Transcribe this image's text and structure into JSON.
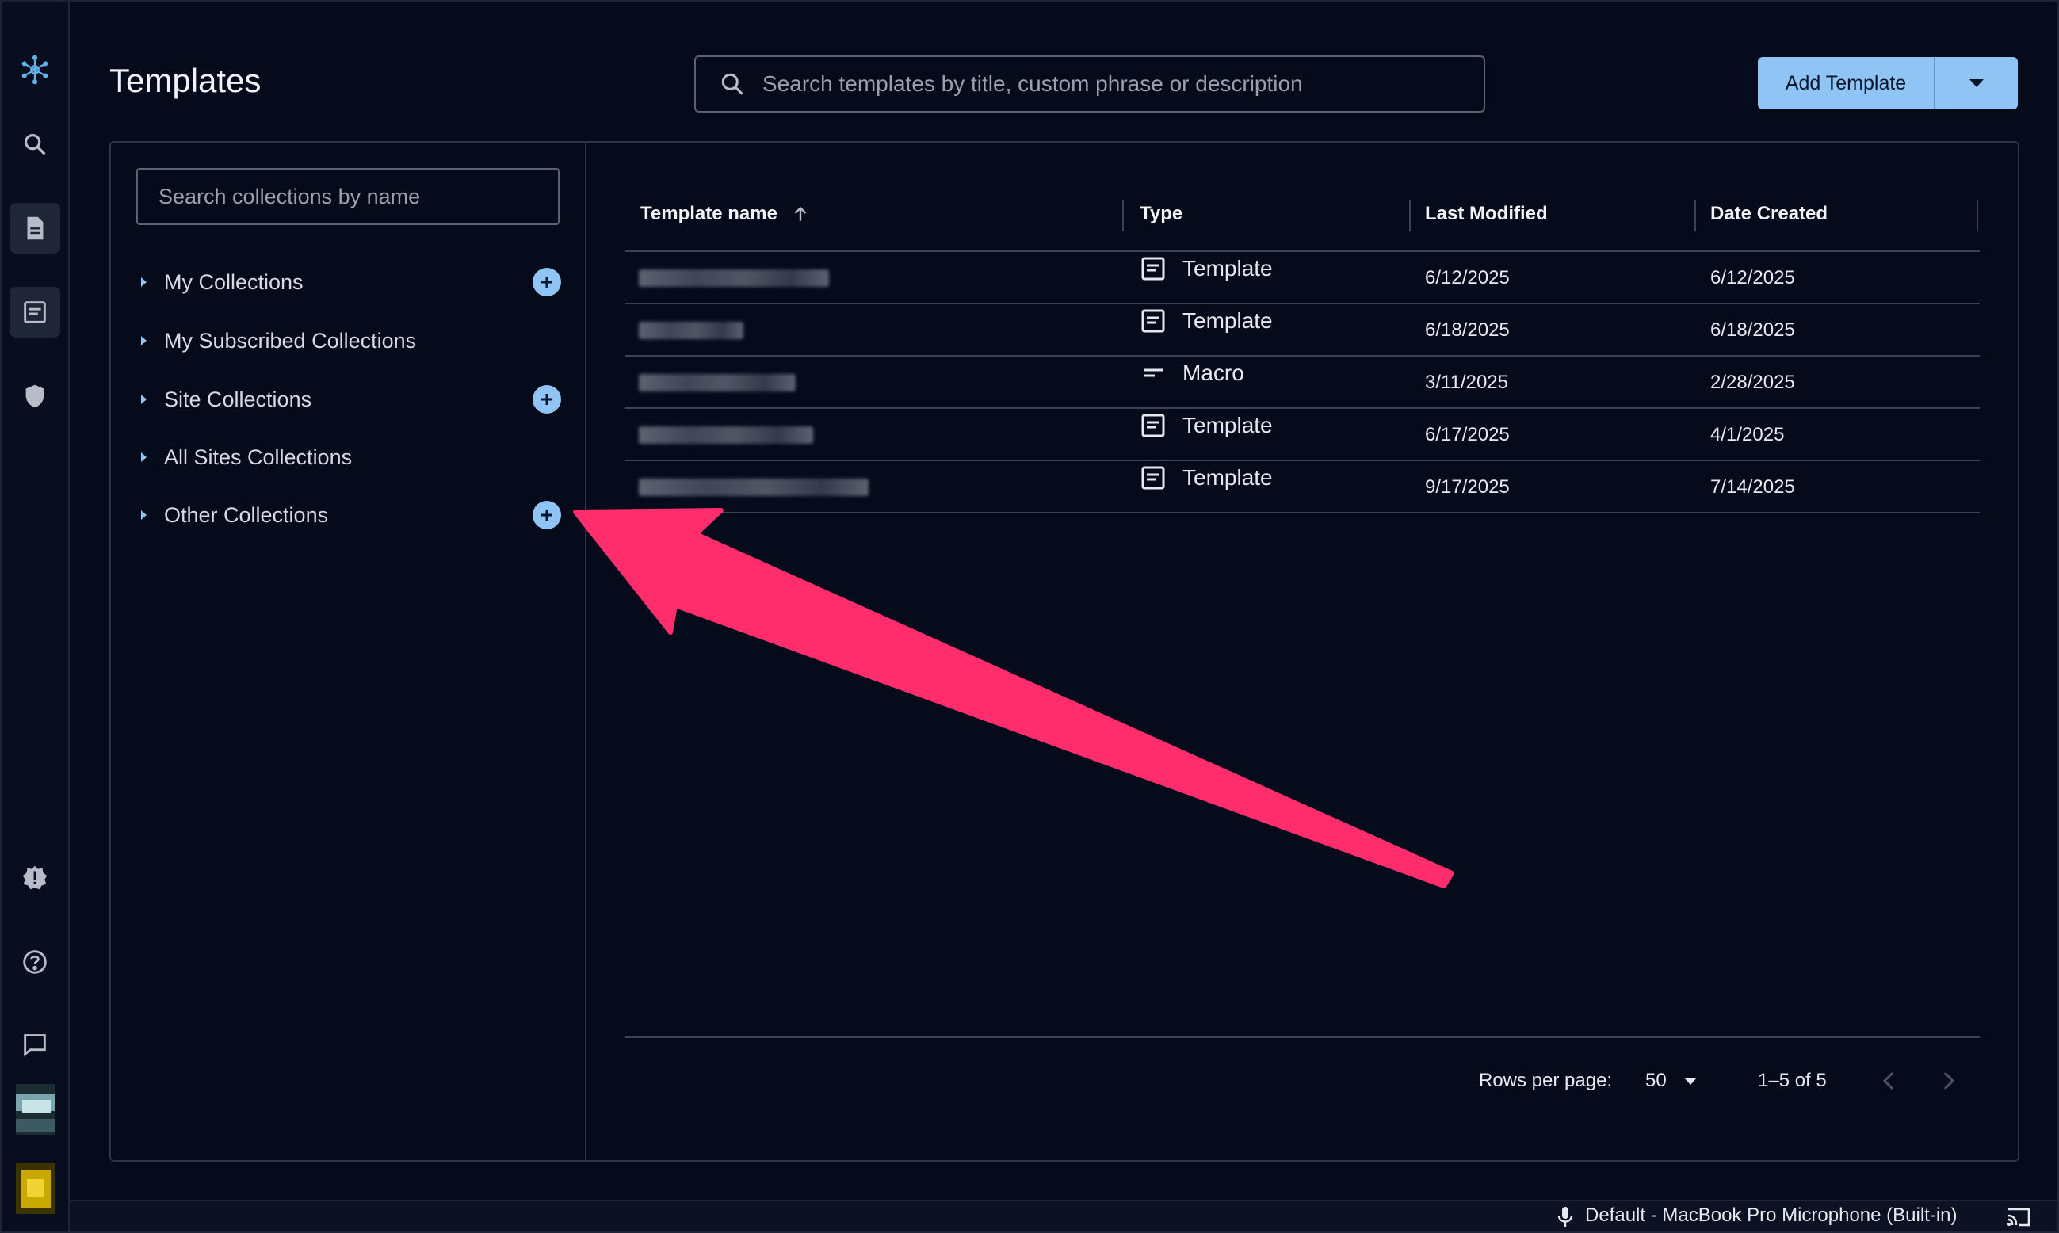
{
  "header": {
    "title": "Templates",
    "search_placeholder": "Search templates by title, custom phrase or description",
    "add_button_label": "Add Template"
  },
  "sidebar": {
    "search_placeholder": "Search collections by name",
    "collections": [
      {
        "label": "My Collections",
        "has_add": true
      },
      {
        "label": "My Subscribed Collections",
        "has_add": false
      },
      {
        "label": "Site Collections",
        "has_add": true
      },
      {
        "label": "All Sites Collections",
        "has_add": false
      },
      {
        "label": "Other Collections",
        "has_add": true
      }
    ]
  },
  "table": {
    "columns": [
      "Template name",
      "Type",
      "Last Modified",
      "Date Created"
    ],
    "sort_icon": "arrow-up-icon",
    "rows": [
      {
        "type": "Template",
        "type_icon": "template-icon",
        "last_modified": "6/12/2025",
        "date_created": "6/12/2025"
      },
      {
        "type": "Template",
        "type_icon": "template-icon",
        "last_modified": "6/18/2025",
        "date_created": "6/18/2025"
      },
      {
        "type": "Macro",
        "type_icon": "macro-icon",
        "last_modified": "3/11/2025",
        "date_created": "2/28/2025"
      },
      {
        "type": "Template",
        "type_icon": "template-icon",
        "last_modified": "6/17/2025",
        "date_created": "4/1/2025"
      },
      {
        "type": "Template",
        "type_icon": "template-icon",
        "last_modified": "9/17/2025",
        "date_created": "7/14/2025"
      }
    ]
  },
  "pagination": {
    "rows_per_page_label": "Rows per page:",
    "rows_per_page_value": "50",
    "range_label": "1–5 of 5"
  },
  "statusbar": {
    "microphone_text": "Default - MacBook Pro Microphone (Built-in)"
  },
  "colors": {
    "background": "#050b1b",
    "accent": "#8fc4f4",
    "annotation_arrow": "#ff2d6b"
  }
}
